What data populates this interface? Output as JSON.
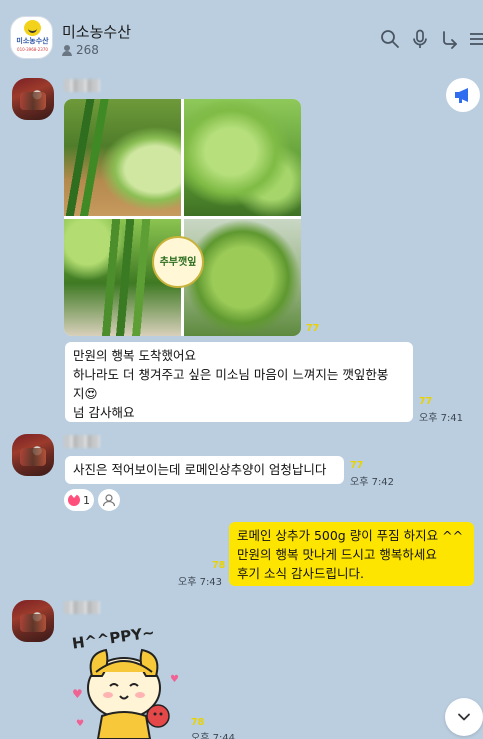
{
  "header": {
    "title": "미소농수산",
    "member_count": "268",
    "logo_text": "미소농수산",
    "logo_phone": "010-3968-2370"
  },
  "messages": [
    {
      "photo_label": "추부깻잎",
      "photo_read_count": "77",
      "text_lines": [
        "만원의 행복 도착했어요",
        "하나라도 더 챙겨주고 싶은 미소님 마음이 느껴지는 깻잎한봉",
        "지😍",
        "넘 감사해요"
      ],
      "read_count": "77",
      "time": "오후 7:41"
    },
    {
      "text": "사진은 적어보이는데 로메인상추양이 엄청납니다",
      "read_count": "77",
      "time": "오후 7:42",
      "reaction_count": "1"
    },
    {
      "mine": true,
      "text_lines": [
        "로메인 상추가 500g 량이 푸짐 하지요 ^^",
        "만원의 행복 맛나게 드시고 행복하세요",
        "후기 소식 감사드립니다."
      ],
      "read_count": "78",
      "time": "오후 7:43"
    },
    {
      "sticker_text": "H^^PPY~",
      "read_count": "78",
      "time": "오후 7:44"
    }
  ],
  "colors": {
    "background": "#bacee0",
    "my_bubble": "#fee500",
    "other_bubble": "#ffffff",
    "read_count": "#e8d200",
    "notice_accent": "#2f6df0"
  },
  "icons": [
    "search-icon",
    "microphone-icon",
    "share-icon",
    "menu-icon",
    "megaphone-icon",
    "chevron-down-icon",
    "heart-icon",
    "add-reaction-icon",
    "person-icon"
  ]
}
